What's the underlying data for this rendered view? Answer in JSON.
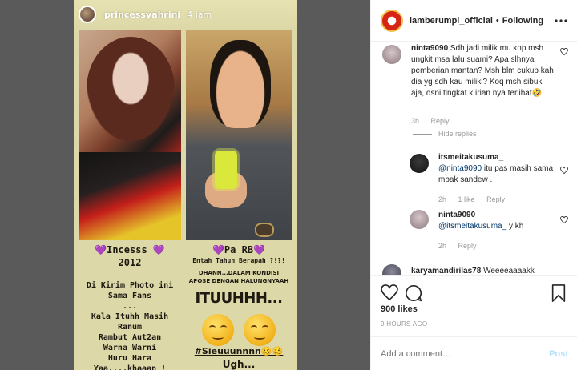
{
  "story": {
    "username": "princessyahrini",
    "time": "4 jam",
    "left_title": "💜Incesss 💜",
    "left_year": "2012",
    "left_body": "Di Kirim Photo ini\nSama Fans\n...\nKala Ituhh Masih Ranum\nRambut Aut2an\nWarna Warni\nHuru Hara\nYaa....khaaan !",
    "right_title": "💜Pa RB💜",
    "right_sub": "Entah Tahun Berapah ?!?!",
    "right_dhann": "DHANN...DALAM KONDISI\nAPOSE DENGAN HALUNGNYAAH",
    "right_itu": "ITUUHHH...",
    "hashtag": "#Sieuuunnnn🥴🥴",
    "ugh": "Ugh..."
  },
  "header": {
    "username": "lamberumpi_official",
    "separator": "•",
    "follow_status": "Following",
    "more_icon": "more-dots-icon"
  },
  "comments": [
    {
      "username": "ninta9090",
      "text": "Sdh jadi milik mu knp msh ungkit msa lalu suami? Apa slhnya pemberian mantan? Msh blm cukup kah dia yg sdh kau miliki? Koq msh sibuk aja, dsni tingkat k irian nya terlihat🤣",
      "time": "3h",
      "reply": "Reply"
    },
    {
      "username": "itsmeitakusuma_",
      "mention": "@ninta9090",
      "text": " itu pas masih sama mbak sandew .",
      "time": "2h",
      "likes": "1 like",
      "reply": "Reply"
    },
    {
      "username": "ninta9090",
      "mention": "@itsmeitakusuma_",
      "text": " y kh",
      "time": "2h",
      "reply": "Reply"
    },
    {
      "username": "karyamandirilas78",
      "text": "Weeeeaaaakk"
    }
  ],
  "hide_replies": "Hide replies",
  "likes": "900 likes",
  "time_ago": "9 HOURS AGO",
  "add_comment_placeholder": "Add a comment…",
  "post_label": "Post"
}
